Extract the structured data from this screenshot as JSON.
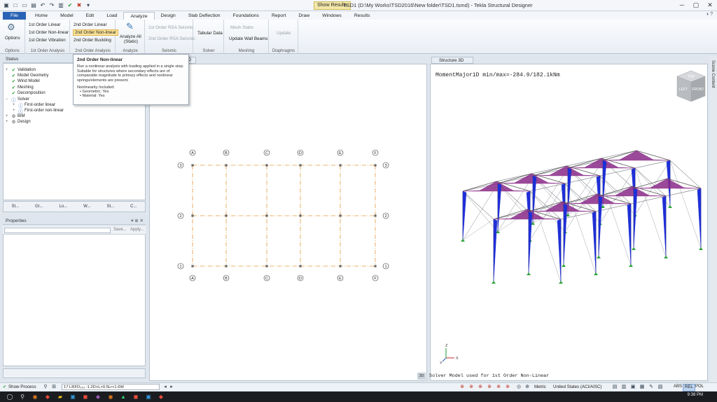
{
  "titlebar": {
    "context_tab": "Show Results",
    "title": "TSD1 (D:\\My Works\\TSD2016\\New folder\\TSD1.tsmd) - Tekla Structural Designer"
  },
  "ribbon_tabs": [
    "File",
    "Home",
    "Model",
    "Edit",
    "Load",
    "Analyze",
    "Design",
    "Slab Deflection",
    "Foundations",
    "Report",
    "Draw",
    "Windows",
    "Results"
  ],
  "ribbon": {
    "options": {
      "btn": "Options",
      "group": "Options"
    },
    "first_order": {
      "linear": "1st Order Linear",
      "nonlinear": "1st Order Non-linear",
      "vibration": "1st Order Vibration",
      "group": "1st Order Analysis"
    },
    "second_order": {
      "linear": "2nd Order Linear",
      "nonlinear": "2nd Order Non-linear",
      "buckling": "2nd Order Buckling",
      "group": "2nd Order Analysis"
    },
    "analyze": {
      "btn1": "Analyze All",
      "btn2": "(Static)",
      "group": "Analyze"
    },
    "seismic": {
      "rsa1": "1st Order RSA Seismic",
      "rsa2": "2nd Order RSA Seismic",
      "group": "Seismic"
    },
    "solver": {
      "btn": "Tabular Data",
      "group": "Solver"
    },
    "meshing": {
      "mesh": "Mesh Slabs",
      "walls": "Update Wall Beams",
      "group": "Meshing"
    },
    "diaphragms": {
      "btn": "Update",
      "group": "Diaphragms"
    }
  },
  "tooltip": {
    "title": "2nd Order Non-linear",
    "body": [
      "Run a nonlinear analysis with loading applied in a single step.",
      "Suitable for structures where secondary effects are of",
      "comparable magnitude to primary effects and nonlinear",
      "springs/elements are present."
    ],
    "subtitle": "Nonlinearity Included:",
    "items": [
      "• Geometric: Yes",
      "• Material: Yes"
    ]
  },
  "status_panel": {
    "title": "Status",
    "tree": [
      {
        "label": "Validation",
        "indent": 0,
        "expander": "+",
        "icon": "check"
      },
      {
        "label": "Model Geometry",
        "indent": 0,
        "expander": "",
        "icon": "check"
      },
      {
        "label": "Wind Model",
        "indent": 0,
        "expander": "",
        "icon": "check"
      },
      {
        "label": "Meshing",
        "indent": 0,
        "expander": "",
        "icon": "check"
      },
      {
        "label": "Decomposition",
        "indent": 0,
        "expander": "",
        "icon": "check"
      },
      {
        "label": "Solver",
        "indent": 0,
        "expander": "−",
        "icon": "info"
      },
      {
        "label": "First-order linear",
        "indent": 1,
        "expander": "+",
        "icon": "info"
      },
      {
        "label": "First-order non-linear",
        "indent": 1,
        "expander": "+",
        "icon": "info"
      },
      {
        "label": "BIM",
        "indent": 0,
        "expander": "+",
        "icon": "gear"
      },
      {
        "label": "Design",
        "indent": 0,
        "expander": "+",
        "icon": "gear"
      }
    ],
    "tabs": [
      "St...",
      "Gr...",
      "Lo...",
      "W...",
      "St...",
      "C..."
    ]
  },
  "properties_panel": {
    "title": "Properties",
    "save": "Save...",
    "apply": "Apply..."
  },
  "view2d": {
    "tab": "2D",
    "grid_x": [
      "A",
      "B",
      "C",
      "D",
      "E",
      "F"
    ],
    "grid_y": [
      "3",
      "2",
      "1"
    ]
  },
  "view3d": {
    "tab": "Structure 3D",
    "readout": "MomentMajor1D min/max=-284.9/182.1kNm",
    "solver_note": "Solver Model used for 1st Order Non-Linear",
    "cube": {
      "top": "TOP",
      "left": "LEFT",
      "front": "FRONT"
    },
    "axes": {
      "x": "X",
      "y": "Y",
      "z": "Z"
    },
    "scene_content": "Scene Content",
    "badge": "3D"
  },
  "statusbar": {
    "show_process": "Show Process",
    "combination": "17 LRFD₂₂₃ -1.2D+L+0.5Lr+1.6W",
    "units": "Metric",
    "code": "United States (ACI/AISC)",
    "modes": [
      "ABS",
      "REL",
      "POL"
    ],
    "active_mode": "REL"
  },
  "taskbar": {
    "time": "9:38 PM"
  },
  "colors": {
    "moment_column": "#1e2fd6",
    "moment_rafter": "#8a2a88",
    "support": "#2fa33a",
    "gridline": "#e39a3c",
    "accent": "#2a63b5"
  }
}
